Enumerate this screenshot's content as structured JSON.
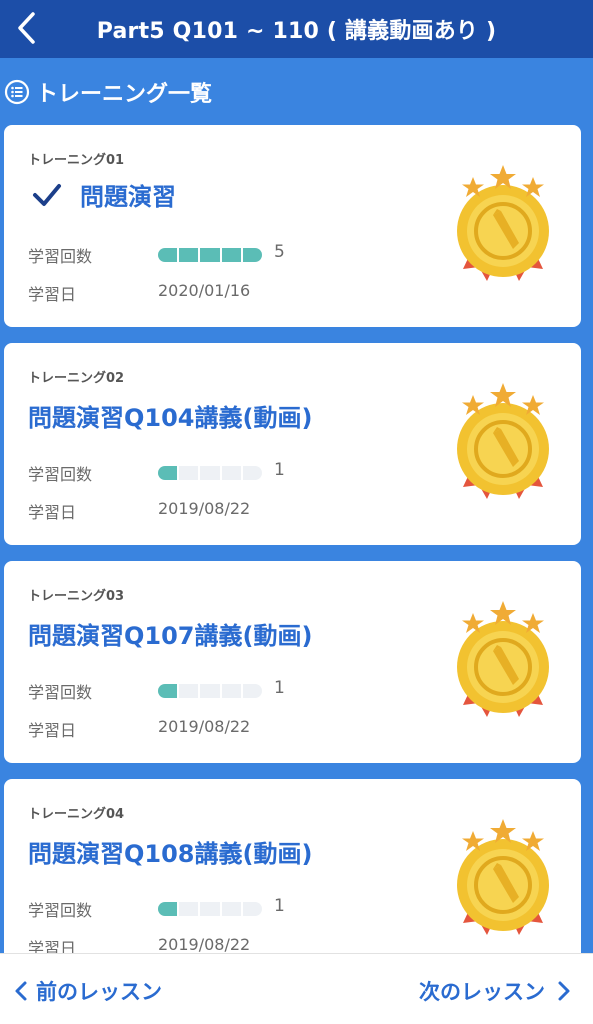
{
  "header": {
    "title": "Part5 Q101 ~ 110 ( 講義動画あり )",
    "back_icon": "chevron-left-icon"
  },
  "section": {
    "title": "トレーニング一覧",
    "icon": "list-icon"
  },
  "labels": {
    "count": "学習回数",
    "date": "学習日"
  },
  "colors": {
    "header": "#1c4ea8",
    "background": "#3a84e0",
    "accent": "#2a6bd0",
    "progress": "#5bbdb6"
  },
  "cards": [
    {
      "label": "トレーニング01",
      "title": "問題演習",
      "checked": true,
      "count": "5",
      "progress": 5,
      "date": "2020/01/16"
    },
    {
      "label": "トレーニング02",
      "title": "問題演習Q104講義(動画)",
      "checked": false,
      "count": "1",
      "progress": 1,
      "date": "2019/08/22"
    },
    {
      "label": "トレーニング03",
      "title": "問題演習Q107講義(動画)",
      "checked": false,
      "count": "1",
      "progress": 1,
      "date": "2019/08/22"
    },
    {
      "label": "トレーニング04",
      "title": "問題演習Q108講義(動画)",
      "checked": false,
      "count": "1",
      "progress": 1,
      "date": "2019/08/22"
    }
  ],
  "footer": {
    "prev_label": "前のレッスン",
    "next_label": "次のレッスン"
  }
}
